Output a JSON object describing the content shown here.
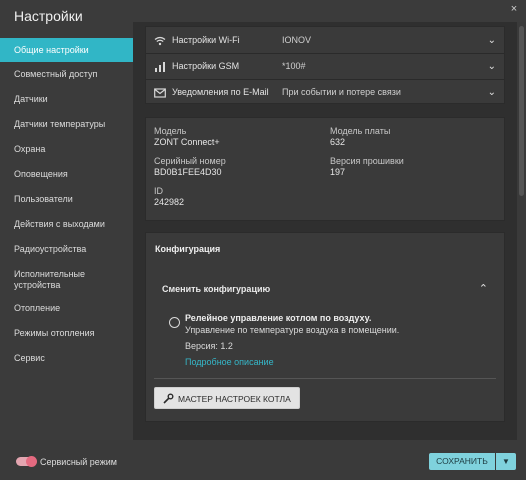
{
  "window": {
    "title": "Настройки",
    "close_icon": "×"
  },
  "sidebar": {
    "items": [
      {
        "label": "Общие настройки",
        "active": true
      },
      {
        "label": "Совместный доступ"
      },
      {
        "label": "Датчики"
      },
      {
        "label": "Датчики температуры"
      },
      {
        "label": "Охрана"
      },
      {
        "label": "Оповещения"
      },
      {
        "label": "Пользователи"
      },
      {
        "label": "Действия с выходами"
      },
      {
        "label": "Радиоустройства"
      },
      {
        "label": "Исполнительные устройства"
      },
      {
        "label": "Отопление"
      },
      {
        "label": "Режимы отопления"
      },
      {
        "label": "Сервис"
      }
    ]
  },
  "connections": [
    {
      "icon": "wifi-icon",
      "label": "Настройки Wi-Fi",
      "value": "IONOV"
    },
    {
      "icon": "signal-icon",
      "label": "Настройки GSM",
      "value": "*100#"
    },
    {
      "icon": "mail-icon",
      "label": "Уведомления по E-Mail",
      "value": "При событии и потере связи"
    }
  ],
  "device_info": {
    "model_label": "Модель",
    "model_value": "ZONT Connect+",
    "board_label": "Модель платы",
    "board_value": "632",
    "serial_label": "Серийный номер",
    "serial_value": "BD0B1FEE4D30",
    "firmware_label": "Версия прошивки",
    "firmware_value": "197",
    "id_label": "ID",
    "id_value": "242982"
  },
  "configuration": {
    "title": "Конфигурация",
    "change_label": "Сменить конфигурацию",
    "option_title": "Релейное управление котлом по воздуху.",
    "option_desc": "Управление по температуре воздуха в помещении.",
    "option_version": "Версия: 1.2",
    "details_link": "Подробное описание",
    "wizard_button": "МАСТЕР НАСТРОЕК КОТЛА"
  },
  "footer": {
    "service_mode_label": "Сервисный режим",
    "service_mode_on": true,
    "save_button": "СОХРАНИТЬ"
  },
  "colors": {
    "accent": "#31b6c6",
    "link": "#35b7c9",
    "toggle": "#e46a80"
  }
}
